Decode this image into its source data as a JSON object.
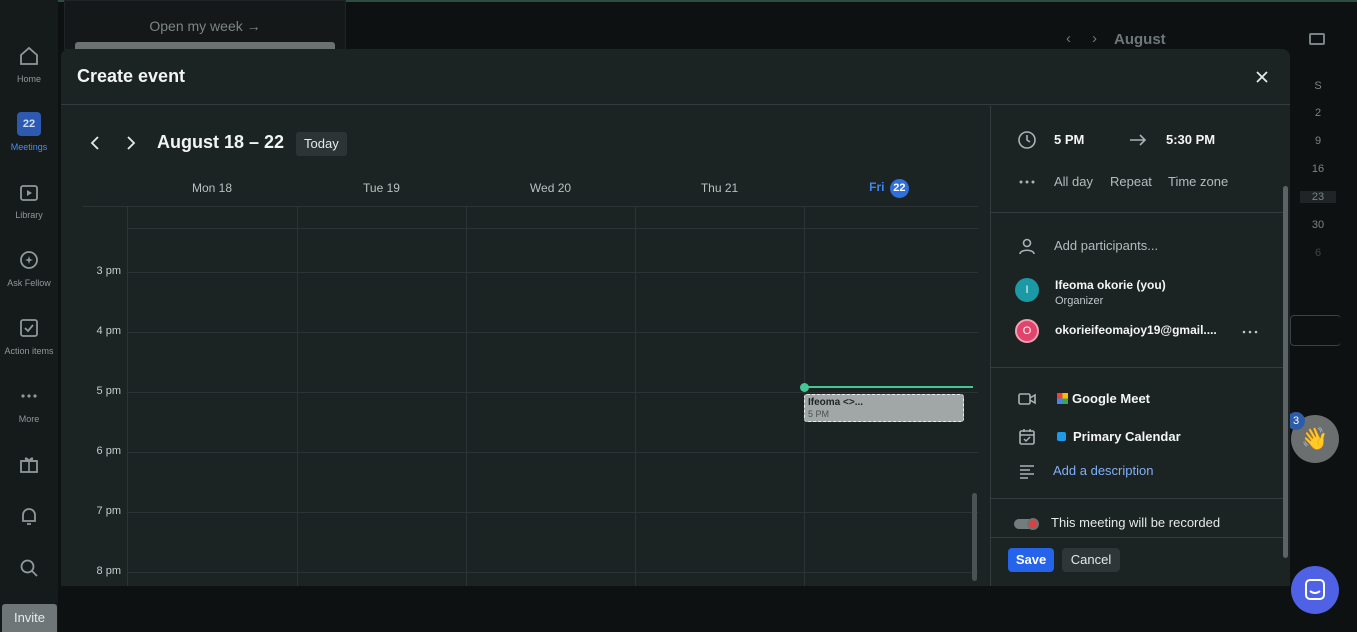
{
  "background": {
    "open_my_week": "Open my week →",
    "right_month": "August",
    "mini_dates": [
      "S",
      "2",
      "9",
      "16",
      "23",
      "30",
      "6"
    ],
    "reactions_badge": "3"
  },
  "rail": {
    "items": [
      {
        "label": "Home",
        "icon": "home-icon"
      },
      {
        "label": "Meetings",
        "icon": "calendar-icon",
        "badge": "22"
      },
      {
        "label": "Library",
        "icon": "library-icon"
      },
      {
        "label": "Ask Fellow",
        "icon": "sparkle-icon"
      },
      {
        "label": "Action items",
        "icon": "checkbox-icon"
      },
      {
        "label": "More",
        "icon": "more-icon"
      }
    ],
    "invite": "Invite"
  },
  "modal": {
    "title": "Create event",
    "calendar": {
      "range": "August 18 – 22",
      "today": "Today",
      "days": [
        {
          "label": "Mon 18"
        },
        {
          "label": "Tue 19"
        },
        {
          "label": "Wed 20"
        },
        {
          "label": "Thu 21"
        },
        {
          "label": "Fri",
          "date": "22",
          "today": true
        }
      ],
      "hours": [
        "3 pm",
        "4 pm",
        "5 pm",
        "6 pm",
        "7 pm",
        "8 pm"
      ],
      "event": {
        "title": "Ifeoma <>...",
        "time": "5 PM"
      }
    },
    "panel": {
      "start_time": "5 PM",
      "end_time": "5:30 PM",
      "all_day": "All day",
      "repeat": "Repeat",
      "time_zone": "Time zone",
      "add_participants": "Add participants...",
      "organizer": {
        "initial": "I",
        "name": "Ifeoma okorie (you)",
        "role": "Organizer",
        "color": "#1b9aa6"
      },
      "guest": {
        "initial": "O",
        "email": "okorieifeomajoy19@gmail....",
        "color": "#e0436b"
      },
      "meet": "Google Meet",
      "calendar_name": "Primary Calendar",
      "calendar_color": "#1e9be8",
      "add_description": "Add a description",
      "recorded": "This meeting will be recorded",
      "save": "Save",
      "cancel": "Cancel"
    }
  }
}
